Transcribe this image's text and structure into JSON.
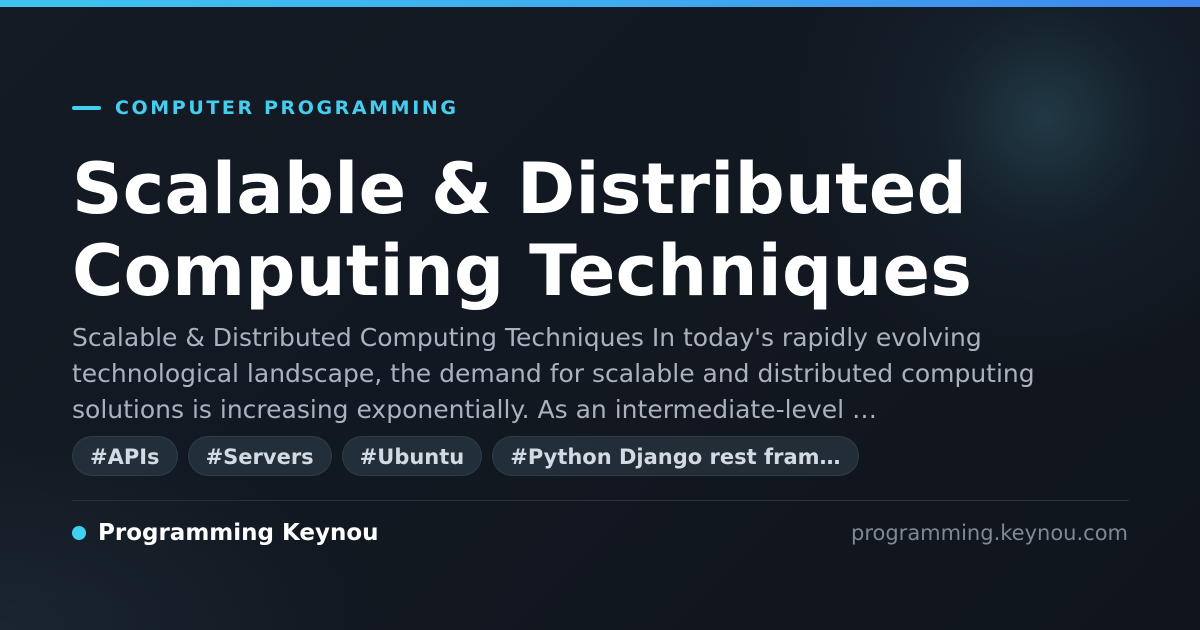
{
  "category": {
    "label": "COMPUTER PROGRAMMING"
  },
  "article": {
    "title": "Scalable & Distributed Computing Techniques",
    "excerpt": "Scalable & Distributed Computing Techniques In today's rapidly evolving technological landscape, the demand for scalable and distributed computing solutions is increasing exponentially. As an intermediate-level …"
  },
  "tags": [
    {
      "label": "#APIs"
    },
    {
      "label": "#Servers"
    },
    {
      "label": "#Ubuntu"
    },
    {
      "label": "#Python Django rest fram…"
    }
  ],
  "footer": {
    "brand_name": "Programming Keynou",
    "domain": "programming.keynou.com"
  },
  "colors": {
    "accent": "#3fd1f2",
    "background": "#11161e",
    "title": "#ffffff",
    "excerpt": "#a9b2be",
    "tag_background": "#283642",
    "tag_text": "#d3dae2",
    "domain_text": "#7f8996"
  }
}
